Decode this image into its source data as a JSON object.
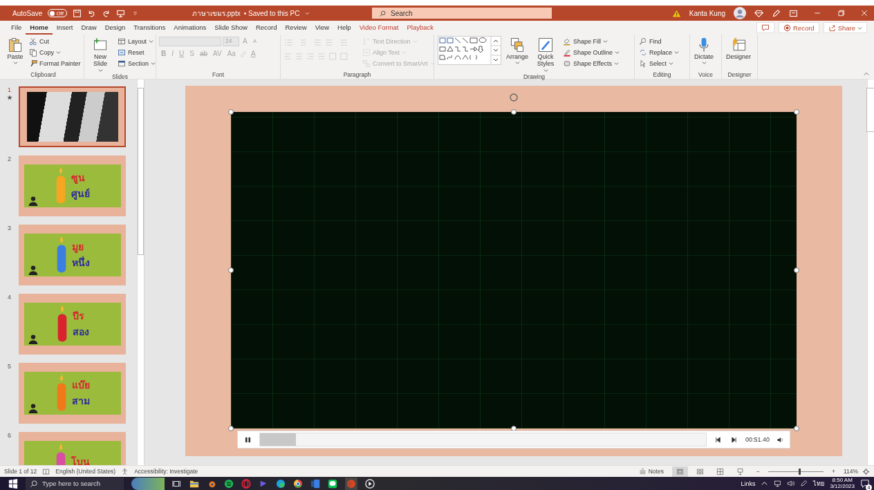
{
  "title_bar": {
    "autosave_label": "AutoSave",
    "autosave_toggle": {
      "label": "Off",
      "on": false
    },
    "file_name": "ภาษาเขมร.pptx",
    "save_status": "• Saved to this PC",
    "search_placeholder": "Search",
    "user_name": "Kanta Kung"
  },
  "menu_tabs": [
    {
      "label": "File",
      "selected": false,
      "kind": "normal"
    },
    {
      "label": "Home",
      "selected": true,
      "kind": "normal"
    },
    {
      "label": "Insert",
      "selected": false,
      "kind": "normal"
    },
    {
      "label": "Draw",
      "selected": false,
      "kind": "normal"
    },
    {
      "label": "Design",
      "selected": false,
      "kind": "normal"
    },
    {
      "label": "Transitions",
      "selected": false,
      "kind": "normal"
    },
    {
      "label": "Animations",
      "selected": false,
      "kind": "normal"
    },
    {
      "label": "Slide Show",
      "selected": false,
      "kind": "normal"
    },
    {
      "label": "Record",
      "selected": false,
      "kind": "normal"
    },
    {
      "label": "Review",
      "selected": false,
      "kind": "normal"
    },
    {
      "label": "View",
      "selected": false,
      "kind": "normal"
    },
    {
      "label": "Help",
      "selected": false,
      "kind": "normal"
    },
    {
      "label": "Video Format",
      "selected": false,
      "kind": "contextual"
    },
    {
      "label": "Playback",
      "selected": false,
      "kind": "contextual"
    }
  ],
  "ribbon_actions": {
    "record": "Record",
    "share": "Share"
  },
  "ribbon": {
    "groups": [
      {
        "label": "Clipboard",
        "disabled": false,
        "items": [
          "Paste",
          "Cut",
          "Copy",
          "Format Painter"
        ]
      },
      {
        "label": "Slides",
        "disabled": false,
        "items": [
          "New Slide",
          "Layout",
          "Reset",
          "Section"
        ]
      },
      {
        "label": "Font",
        "disabled": true,
        "items": [
          "24",
          "A",
          "A",
          "B",
          "I",
          "U",
          "S",
          "ab",
          "AV",
          "Aa",
          "A"
        ]
      },
      {
        "label": "Paragraph",
        "disabled": true,
        "items": [
          "Text Direction",
          "Align Text",
          "Convert to SmartArt"
        ]
      },
      {
        "label": "Drawing",
        "disabled": false,
        "items": [
          "Arrange",
          "Quick Styles",
          "Shape Fill",
          "Shape Outline",
          "Shape Effects"
        ]
      },
      {
        "label": "Editing",
        "disabled": false,
        "items": [
          "Find",
          "Replace",
          "Select"
        ]
      },
      {
        "label": "Voice",
        "disabled": false,
        "items": [
          "Dictate"
        ]
      },
      {
        "label": "Designer",
        "disabled": false,
        "items": [
          "Designer"
        ]
      }
    ]
  },
  "slides": [
    {
      "number": "1",
      "selected": true,
      "animated": true,
      "kind": "photo"
    },
    {
      "number": "2",
      "selected": false,
      "animated": false,
      "kind": "candle",
      "top_word": "ซูน",
      "bottom_word": "ศูนย์",
      "color": "#f5a623"
    },
    {
      "number": "3",
      "selected": false,
      "animated": false,
      "kind": "candle",
      "top_word": "มูย",
      "bottom_word": "หนึ่ง",
      "color": "#3b7fe0"
    },
    {
      "number": "4",
      "selected": false,
      "animated": false,
      "kind": "candle",
      "top_word": "ปีร",
      "bottom_word": "สอง",
      "color": "#d9232e"
    },
    {
      "number": "5",
      "selected": false,
      "animated": false,
      "kind": "candle",
      "top_word": "แบ๊ย",
      "bottom_word": "สาม",
      "color": "#f07a1a"
    },
    {
      "number": "6",
      "selected": false,
      "animated": false,
      "kind": "candle",
      "top_word": "โบน",
      "color": "#d94fa3"
    }
  ],
  "player": {
    "level": 0.08,
    "time": "00:51.40"
  },
  "status_bar": {
    "slide_info": "Slide 1 of 12",
    "language": "English (United States)",
    "accessibility": "Accessibility: Investigate",
    "notes": "Notes",
    "views": [
      {
        "selected": true
      },
      {
        "selected": false
      },
      {
        "selected": false
      },
      {
        "selected": false
      }
    ],
    "zoom_minus": "−",
    "zoom": {
      "level": 0.55
    },
    "zoom_plus": "+",
    "zoom_percent": "114%"
  },
  "taskbar": {
    "search_placeholder": "Type here to search",
    "links": "Links",
    "language": "ไทย",
    "time": "8:50 AM",
    "date": "3/12/2023",
    "notification_count": "4"
  }
}
